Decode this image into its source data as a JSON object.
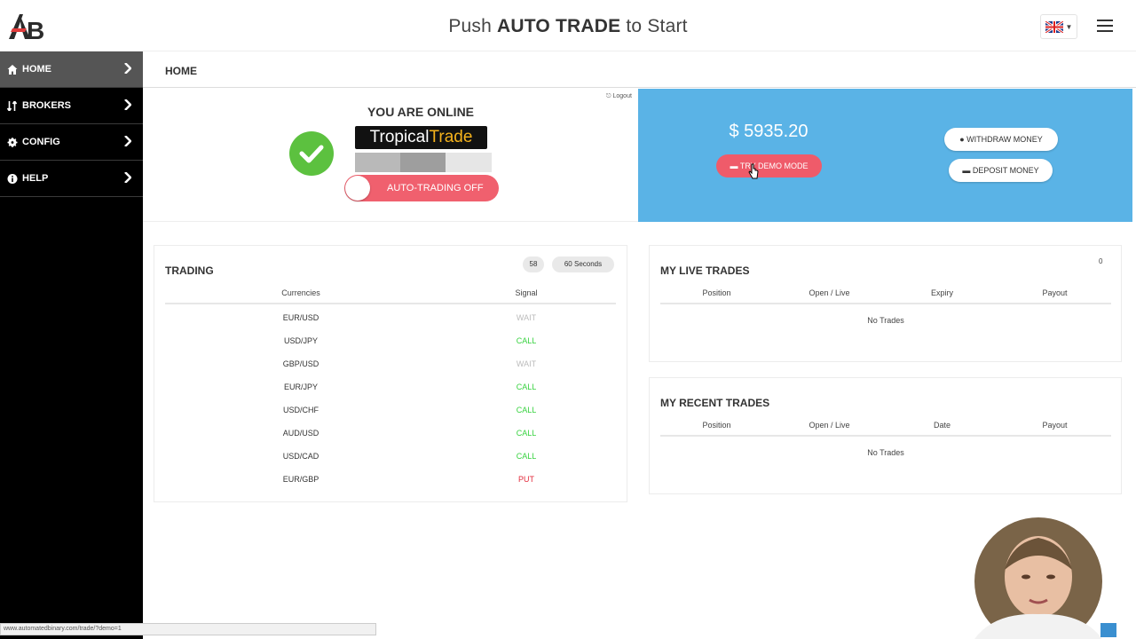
{
  "header": {
    "logo_text": "AB",
    "title_prefix": "Push",
    "title_bold": "AUTO TRADE",
    "title_suffix": "to Start",
    "language_flag": "uk-flag-icon"
  },
  "sidebar": {
    "items": [
      {
        "label": "HOME",
        "icon": "home-icon"
      },
      {
        "label": "BROKERS",
        "icon": "brokers-icon"
      },
      {
        "label": "CONFIG",
        "icon": "gear-icon"
      },
      {
        "label": "HELP",
        "icon": "info-icon"
      }
    ]
  },
  "breadcrumb": "HOME",
  "status_panel": {
    "title": "YOU ARE ONLINE",
    "brand_first": "Tropical",
    "brand_second": "Trade",
    "auto_trading_label": "AUTO-TRADING OFF",
    "logout_label": "Logout"
  },
  "account": {
    "balance": "$ 5935.20",
    "demo_label": "TRY DEMO MODE",
    "withdraw_label": "WITHDRAW MONEY",
    "deposit_label": "DEPOSIT MONEY"
  },
  "trading": {
    "title": "TRADING",
    "countdown": "58",
    "interval": "60 Seconds",
    "columns": [
      "Currencies",
      "Signal"
    ],
    "rows": [
      {
        "pair": "EUR/USD",
        "signal": "WAIT",
        "class": "wait"
      },
      {
        "pair": "USD/JPY",
        "signal": "CALL",
        "class": "call"
      },
      {
        "pair": "GBP/USD",
        "signal": "WAIT",
        "class": "wait"
      },
      {
        "pair": "EUR/JPY",
        "signal": "CALL",
        "class": "call"
      },
      {
        "pair": "USD/CHF",
        "signal": "CALL",
        "class": "call"
      },
      {
        "pair": "AUD/USD",
        "signal": "CALL",
        "class": "call"
      },
      {
        "pair": "USD/CAD",
        "signal": "CALL",
        "class": "call"
      },
      {
        "pair": "EUR/GBP",
        "signal": "PUT",
        "class": "put"
      }
    ]
  },
  "live_trades": {
    "title": "MY LIVE TRADES",
    "count": "0",
    "columns": [
      "Position",
      "Open / Live",
      "Expiry",
      "Payout"
    ],
    "empty_text": "No Trades"
  },
  "recent_trades": {
    "title": "MY RECENT TRADES",
    "columns": [
      "Position",
      "Open / Live",
      "Date",
      "Payout"
    ],
    "empty_text": "No Trades"
  },
  "status_bar": {
    "url": "www.automatedbinary.com/trade/?demo=1"
  },
  "colors": {
    "accent_blue": "#5ab3e6",
    "danger_red": "#ef5b6a",
    "success_green": "#5cc13f",
    "call_green": "#37d23f",
    "put_red": "#e22b3b"
  }
}
